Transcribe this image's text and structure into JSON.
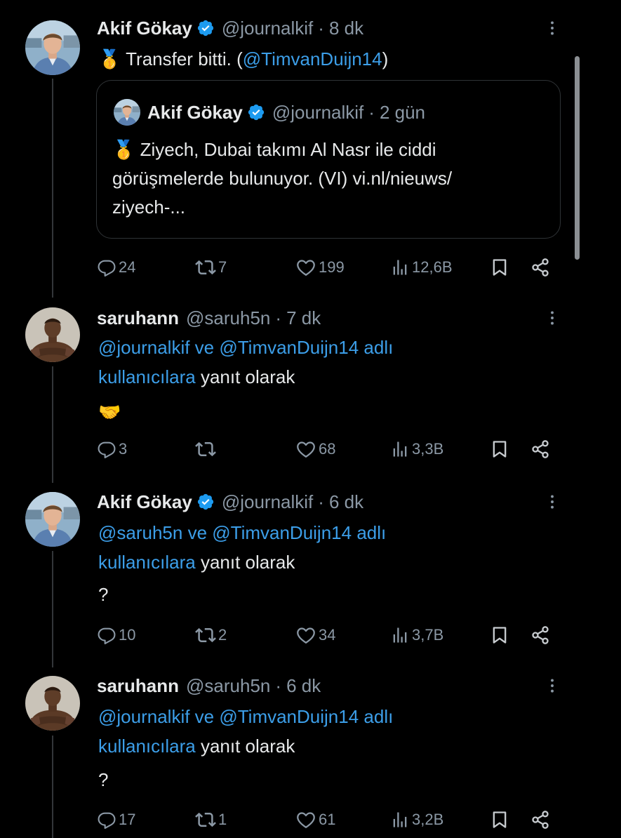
{
  "tweets": [
    {
      "author": "Akif Gökay",
      "verified": true,
      "handle": "@journalkif",
      "sep": "·",
      "time": "8 dk",
      "text_prefix": "🥇 Transfer bitti. (",
      "text_mention": "@TimvanDuijn14",
      "text_suffix": ")",
      "quote": {
        "author": "Akif Gökay",
        "handle": "@journalkif",
        "sep": "·",
        "time": "2 gün",
        "lines": [
          "🥇 Ziyech, Dubai takımı Al Nasr ile ciddi",
          "görüşmelerde bulunuyor. (VI) vi.nl/nieuws/",
          "ziyech-..."
        ]
      },
      "replies": "24",
      "retweets": "7",
      "likes": "199",
      "views": "12,6B"
    },
    {
      "author": "saruhann",
      "handle": "@saruh5n",
      "sep": "·",
      "time": "7 dk",
      "reply_line1_mentions": "@journalkif ve @TimvanDuijn14 adlı",
      "reply_line2_link": "kullanıcılara",
      "reply_line2_rest": " yanıt olarak",
      "body": "🤝",
      "replies": "3",
      "retweets": "",
      "likes": "68",
      "views": "3,3B"
    },
    {
      "author": "Akif Gökay",
      "verified": true,
      "handle": "@journalkif",
      "sep": "·",
      "time": "6 dk",
      "reply_line1_mentions": "@saruh5n ve @TimvanDuijn14 adlı",
      "reply_line2_link": "kullanıcılara",
      "reply_line2_rest": " yanıt olarak",
      "body": "?",
      "replies": "10",
      "retweets": "2",
      "likes": "34",
      "views": "3,7B"
    },
    {
      "author": "saruhann",
      "handle": "@saruh5n",
      "sep": "·",
      "time": "6 dk",
      "reply_line1_mentions": "@journalkif ve @TimvanDuijn14 adlı",
      "reply_line2_link": "kullanıcılara",
      "reply_line2_rest": " yanıt olarak",
      "body": "?",
      "replies": "17",
      "retweets": "1",
      "likes": "61",
      "views": "3,2B"
    }
  ],
  "colors": {
    "background": "#000000",
    "text": "#e7e9ea",
    "secondary": "#8b98a5",
    "link": "#3c9ee8",
    "verified": "#1d9bf0"
  },
  "icons": [
    "verified-badge-icon",
    "more-icon",
    "reply-icon",
    "retweet-icon",
    "like-icon",
    "views-icon",
    "bookmark-icon",
    "share-icon"
  ]
}
